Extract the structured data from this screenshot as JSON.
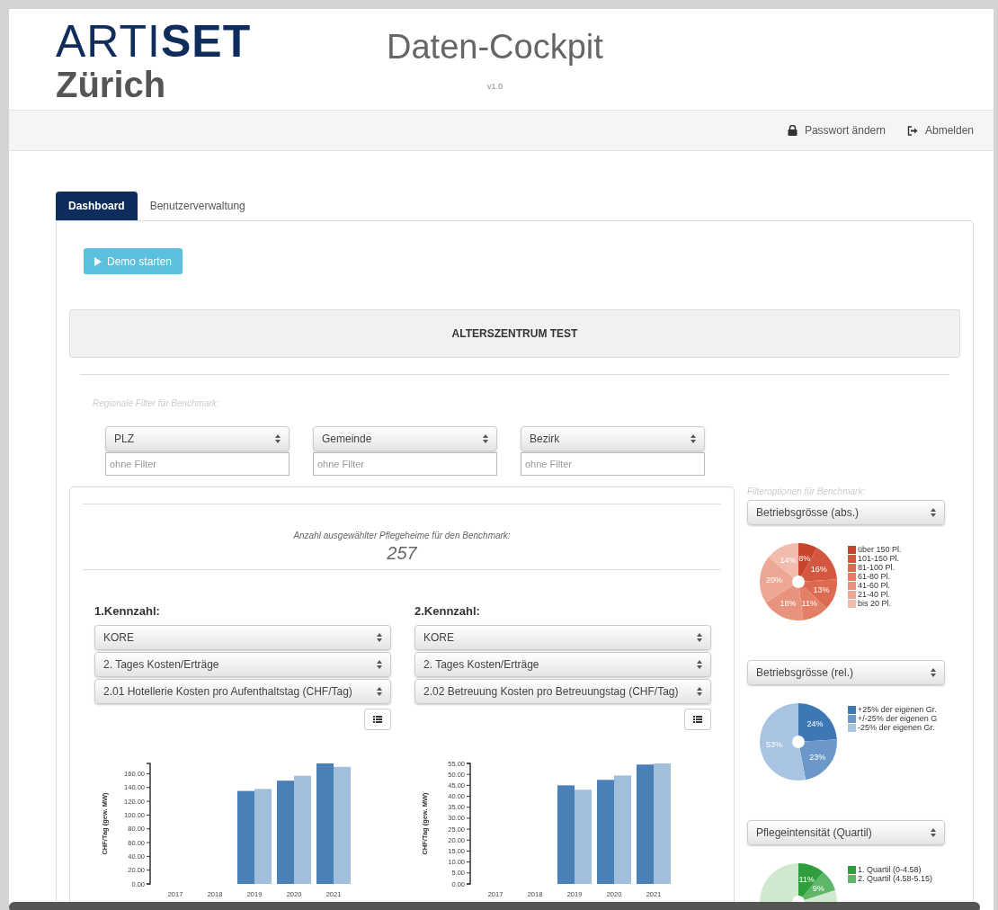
{
  "header": {
    "logo_text": "ARTI**SET**",
    "logo_city": "Zürich",
    "title": "Daten-Cockpit",
    "version": "v1.0"
  },
  "nav": [
    {
      "kind": "lock",
      "label": "Passwort ändern"
    },
    {
      "kind": "logout",
      "label": "Abmelden"
    }
  ],
  "tabs": [
    {
      "label": "Dashboard",
      "selected": true
    },
    {
      "label": "Benutzerverwaltung",
      "selected": false
    }
  ],
  "demo_button": {
    "label": "Demo starten"
  },
  "facility_title": "ALTERSZENTRUM TEST",
  "regional_filter": {
    "label": "Regionale Filter für Benchmark:",
    "filters": [
      {
        "select": "PLZ",
        "placeholder": "ohne Filter"
      },
      {
        "select": "Gemeinde",
        "placeholder": "ohne Filter"
      },
      {
        "select": "Bezirk",
        "placeholder": "ohne Filter"
      }
    ]
  },
  "benchmark_count": {
    "label": "Anzahl ausgewählter Pflegeheime für den Benchmark:",
    "value": "257"
  },
  "kennzahlen": [
    {
      "heading": "1.Kennzahl:",
      "selects": [
        "KORE",
        "2. Tages Kosten/Erträge",
        "2.01 Hotellerie Kosten pro Aufenthaltstag (CHF/Tag)"
      ],
      "chart_data": {
        "type": "bar",
        "ylabel": "CHF/Tag (gew. MW)",
        "categories": [
          "2017",
          "2018",
          "2019",
          "2020",
          "2021"
        ],
        "ylim": [
          0,
          175
        ],
        "yticks": [
          {
            "value": 0,
            "label": "0.00"
          },
          {
            "value": 20,
            "label": "20.00"
          },
          {
            "value": 40,
            "label": "40.00"
          },
          {
            "value": 60,
            "label": "60.00"
          },
          {
            "value": 80,
            "label": "80.00"
          },
          {
            "value": 100,
            "label": "100.00"
          },
          {
            "value": 120,
            "label": "120.00"
          },
          {
            "value": 140,
            "label": "140.00"
          },
          {
            "value": 160,
            "label": "160.00"
          }
        ],
        "series": [
          {
            "color": "#4a80b8",
            "values": [
              null,
              null,
              135,
              150,
              175
            ]
          },
          {
            "color": "#9fbfdc",
            "values": [
              null,
              null,
              138,
              157,
              170
            ]
          }
        ]
      }
    },
    {
      "heading": "2.Kennzahl:",
      "selects": [
        "KORE",
        "2. Tages Kosten/Erträge",
        "2.02 Betreuung Kosten pro Betreuungstag (CHF/Tag)"
      ],
      "chart_data": {
        "type": "bar",
        "ylabel": "CHF/Tag (gew. MW)",
        "categories": [
          "2017",
          "2018",
          "2019",
          "2020",
          "2021"
        ],
        "ylim": [
          0,
          55
        ],
        "yticks": [
          {
            "value": 0,
            "label": "0.00"
          },
          {
            "value": 5,
            "label": "5.00"
          },
          {
            "value": 10,
            "label": "10.00"
          },
          {
            "value": 15,
            "label": "15.00"
          },
          {
            "value": 20,
            "label": "20.00"
          },
          {
            "value": 25,
            "label": "25.00"
          },
          {
            "value": 30,
            "label": "30.00"
          },
          {
            "value": 35,
            "label": "35.00"
          },
          {
            "value": 40,
            "label": "40.00"
          },
          {
            "value": 45,
            "label": "45.00"
          },
          {
            "value": 50,
            "label": "50.00"
          },
          {
            "value": 55,
            "label": "55.00"
          }
        ],
        "series": [
          {
            "color": "#4a80b8",
            "values": [
              null,
              null,
              45,
              47.5,
              54.5
            ]
          },
          {
            "color": "#9fbfdc",
            "values": [
              null,
              null,
              43,
              49.5,
              55
            ]
          }
        ]
      }
    }
  ],
  "filter_options": {
    "label": "Filteroptionen für Benchmark:",
    "groups": [
      {
        "select": "Betriebsgrösse (abs.)",
        "chart_data": {
          "type": "pie",
          "categories": [
            "über 150 Pl.",
            "101-150 Pl.",
            "81-100 Pl.",
            "61-80 Pl.",
            "41-60 Pl.",
            "21-40 Pl.",
            "bis 20 Pl."
          ],
          "values": [
            8,
            16,
            13,
            11,
            18,
            20,
            14
          ],
          "colors": [
            "#c9442a",
            "#d4583f",
            "#dc6b52",
            "#e37f66",
            "#e8937d",
            "#eda795",
            "#f1bcae"
          ],
          "value_labels": [
            "8%",
            "16%",
            "13%",
            "11%",
            "18%",
            "20%",
            "14%"
          ]
        }
      },
      {
        "select": "Betriebsgrösse (rel.)",
        "chart_data": {
          "type": "pie",
          "categories": [
            "+25% der eigenen Gr.",
            "+/-25% der eigenen G",
            "-25% der eigenen Gr."
          ],
          "values": [
            24,
            23,
            53
          ],
          "colors": [
            "#3d78b5",
            "#6b98c9",
            "#a8c4e2"
          ],
          "value_labels": [
            "24%",
            "23%",
            "53%"
          ]
        }
      },
      {
        "select": "Pflegeintensität (Quartil)",
        "chart_data": {
          "type": "pie",
          "categories": [
            "1. Quartil (0-4.58)",
            "2. Quartil (4.58-5.15)"
          ],
          "values": [
            11,
            9
          ],
          "colors": [
            "#2f9e3c",
            "#5db766"
          ],
          "value_labels": [
            "11%",
            "9%"
          ]
        }
      }
    ]
  }
}
